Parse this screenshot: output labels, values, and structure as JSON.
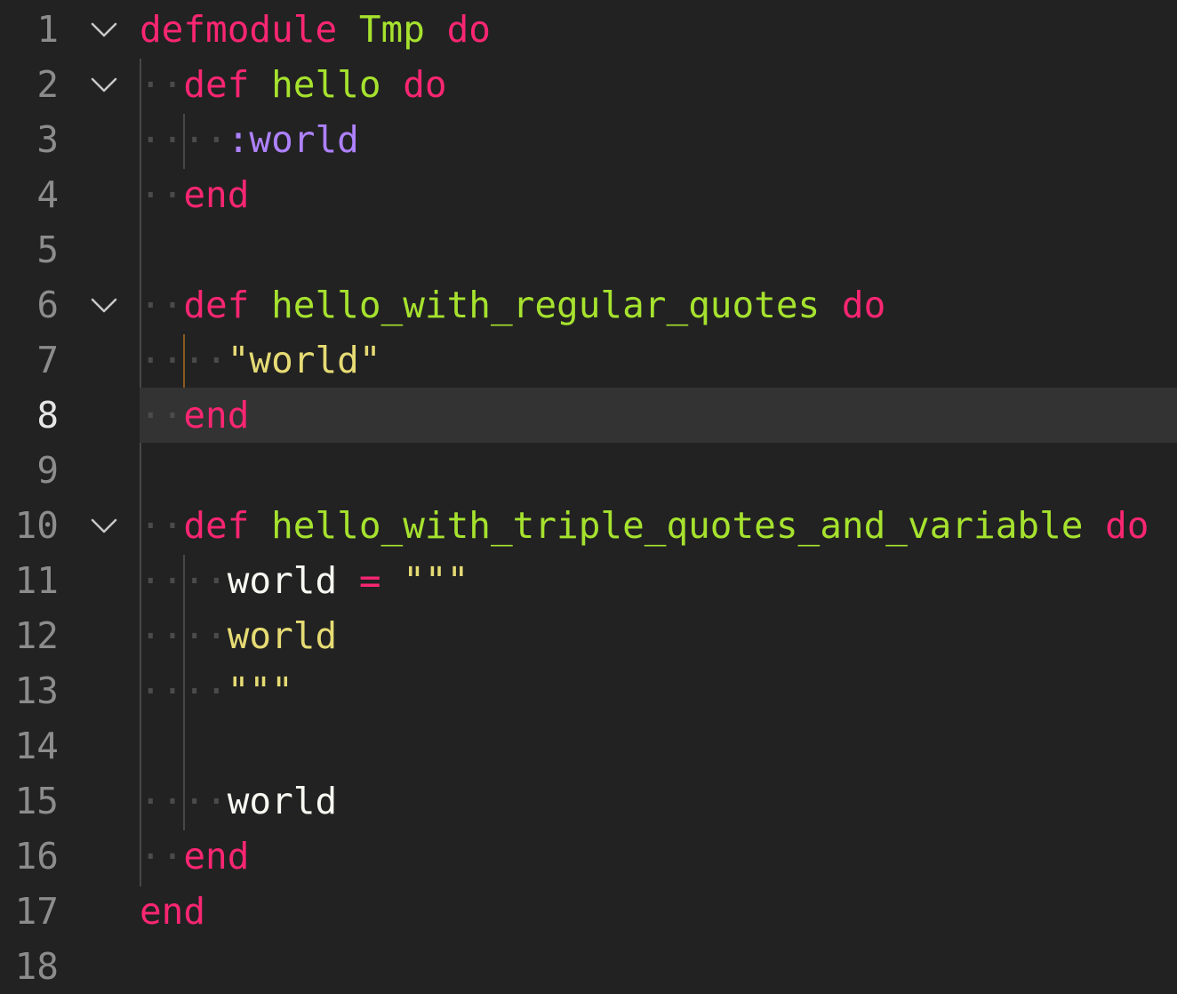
{
  "editor": {
    "current_line": 8,
    "lines": [
      {
        "n": "1",
        "fold": true,
        "tokens": [
          {
            "t": "kw",
            "v": "defmodule"
          },
          {
            "t": "var",
            "v": " "
          },
          {
            "t": "mod",
            "v": "Tmp"
          },
          {
            "t": "var",
            "v": " "
          },
          {
            "t": "kw",
            "v": "do"
          }
        ]
      },
      {
        "n": "2",
        "fold": true,
        "tokens": [
          {
            "t": "ws",
            "v": "··"
          },
          {
            "t": "kw",
            "v": "def"
          },
          {
            "t": "var",
            "v": " "
          },
          {
            "t": "fn",
            "v": "hello"
          },
          {
            "t": "var",
            "v": " "
          },
          {
            "t": "kw",
            "v": "do"
          }
        ]
      },
      {
        "n": "3",
        "fold": false,
        "tokens": [
          {
            "t": "ws",
            "v": "····"
          },
          {
            "t": "atom",
            "v": ":world"
          }
        ]
      },
      {
        "n": "4",
        "fold": false,
        "tokens": [
          {
            "t": "ws",
            "v": "··"
          },
          {
            "t": "kw",
            "v": "end"
          }
        ]
      },
      {
        "n": "5",
        "fold": false,
        "tokens": []
      },
      {
        "n": "6",
        "fold": true,
        "tokens": [
          {
            "t": "ws",
            "v": "··"
          },
          {
            "t": "kw",
            "v": "def"
          },
          {
            "t": "var",
            "v": " "
          },
          {
            "t": "fn",
            "v": "hello_with_regular_quotes"
          },
          {
            "t": "var",
            "v": " "
          },
          {
            "t": "kw",
            "v": "do"
          }
        ]
      },
      {
        "n": "7",
        "fold": false,
        "tokens": [
          {
            "t": "ws",
            "v": "····"
          },
          {
            "t": "str",
            "v": "\"world\""
          }
        ]
      },
      {
        "n": "8",
        "fold": false,
        "tokens": [
          {
            "t": "ws",
            "v": "··"
          },
          {
            "t": "kw",
            "v": "end"
          }
        ]
      },
      {
        "n": "9",
        "fold": false,
        "tokens": []
      },
      {
        "n": "10",
        "fold": true,
        "tokens": [
          {
            "t": "ws",
            "v": "··"
          },
          {
            "t": "kw",
            "v": "def"
          },
          {
            "t": "var",
            "v": " "
          },
          {
            "t": "fn",
            "v": "hello_with_triple_quotes_and_variable"
          },
          {
            "t": "var",
            "v": " "
          },
          {
            "t": "kw",
            "v": "do"
          }
        ]
      },
      {
        "n": "11",
        "fold": false,
        "tokens": [
          {
            "t": "ws",
            "v": "····"
          },
          {
            "t": "var",
            "v": "world"
          },
          {
            "t": "var",
            "v": " "
          },
          {
            "t": "op",
            "v": "="
          },
          {
            "t": "var",
            "v": " "
          },
          {
            "t": "str",
            "v": "\"\"\""
          }
        ]
      },
      {
        "n": "12",
        "fold": false,
        "tokens": [
          {
            "t": "ws",
            "v": "····"
          },
          {
            "t": "str",
            "v": "world"
          }
        ]
      },
      {
        "n": "13",
        "fold": false,
        "tokens": [
          {
            "t": "ws",
            "v": "····"
          },
          {
            "t": "str",
            "v": "\"\"\""
          }
        ]
      },
      {
        "n": "14",
        "fold": false,
        "tokens": []
      },
      {
        "n": "15",
        "fold": false,
        "tokens": [
          {
            "t": "ws",
            "v": "····"
          },
          {
            "t": "var",
            "v": "world"
          }
        ]
      },
      {
        "n": "16",
        "fold": false,
        "tokens": [
          {
            "t": "ws",
            "v": "··"
          },
          {
            "t": "kw",
            "v": "end"
          }
        ]
      },
      {
        "n": "17",
        "fold": false,
        "tokens": [
          {
            "t": "kw",
            "v": "end"
          }
        ]
      },
      {
        "n": "18",
        "fold": false,
        "tokens": []
      }
    ]
  },
  "colors": {
    "background": "#222222",
    "current_line": "#333333",
    "keyword": "#f92672",
    "function": "#a6e22e",
    "atom": "#ae81ff",
    "string": "#e6db74",
    "text": "#f8f8f2",
    "line_number": "#8c8c8c",
    "active_guide": "#8a5a1f"
  },
  "icons": {
    "fold": "chevron-down-icon"
  }
}
